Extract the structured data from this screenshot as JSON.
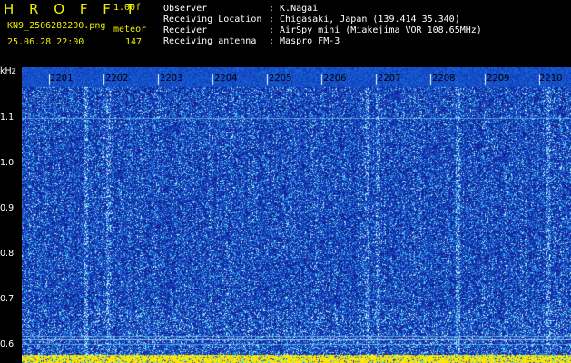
{
  "header": {
    "title": "H R O F F T",
    "version": "1.00f",
    "filename": "KN9_2506282200.png",
    "mode": "meteor",
    "datetime": "25.06.28 22:00",
    "count": "147",
    "info": [
      {
        "label": "Observer",
        "value": ": K.Nagai"
      },
      {
        "label": "Receiving Location",
        "value": ": Chigasaki, Japan (139.414 35.340)"
      },
      {
        "label": "Receiver",
        "value": ": AirSpy mini (Miakejima VOR 108.65MHz)"
      },
      {
        "label": "Receiving antenna",
        "value": ": Maspro FM-3"
      }
    ]
  },
  "axis": {
    "unit": "kHz",
    "y_ticks": [
      "1.1",
      "1.0",
      "0.9",
      "0.8",
      "0.7",
      "0.6"
    ],
    "x_ticks": [
      "2201",
      "2202",
      "2203",
      "2204",
      "2205",
      "2206",
      "2207",
      "2208",
      "2209",
      "2210"
    ]
  },
  "colors": {
    "background": "#000000",
    "header_accent": "#f0f000",
    "spectrogram_base": "#1a2fb0",
    "spectrogram_noise": "#38c8f0",
    "time_band": "#ffe400"
  }
}
